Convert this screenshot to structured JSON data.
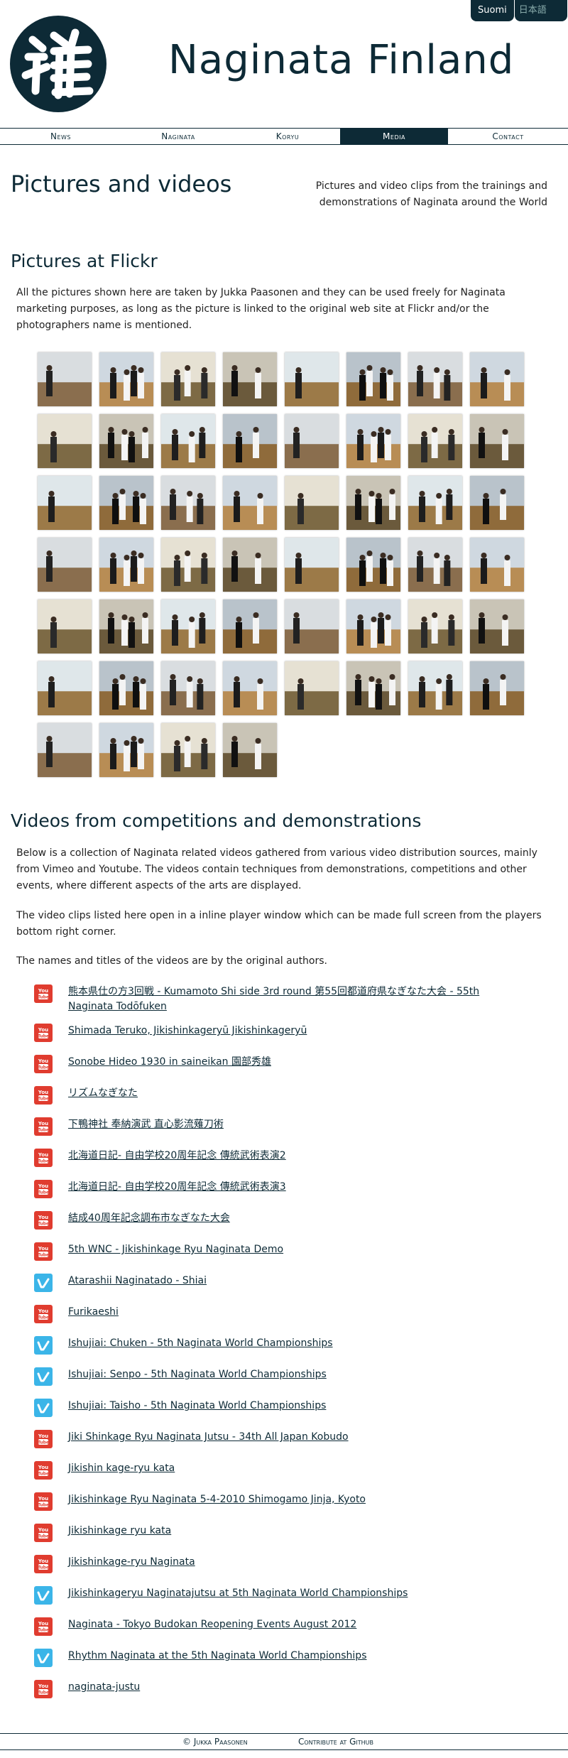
{
  "header": {
    "brand_title": "Naginata Finland",
    "language_link": "Suomi",
    "language_link_2": "日本語"
  },
  "nav": [
    {
      "label": "News"
    },
    {
      "label": "Naginata"
    },
    {
      "label": "Koryu"
    },
    {
      "label": "Media"
    },
    {
      "label": "Contact"
    }
  ],
  "page": {
    "title": "Pictures and videos",
    "intro": "Pictures and video clips from the trainings and demonstrations of Naginata around the World"
  },
  "flickr": {
    "heading": "Pictures at Flickr",
    "description": "All the pictures shown here are taken by Jukka Paasonen and they can be used freely for Naginata marketing purposes, as long as the picture is linked to the original web site at Flickr and/or the photographers name is mentioned.",
    "photo_count": 52
  },
  "videos": {
    "heading": "Videos from competitions and demonstrations",
    "paragraph1": "Below is a collection of Naginata related videos gathered from various video distribution sources, mainly from Vimeo and Youtube. The videos contain techniques from demonstrations, competitions and other events, where different aspects of the arts are displayed.",
    "paragraph2": "The video clips listed here open in a inline player window which can be made full screen from the players bottom right corner.",
    "paragraph3": "The names and titles of the videos are by the original authors.",
    "items": [
      {
        "title": "熊本県仕の方3回戦 - Kumamoto Shi side 3rd round 第55回都道府県なぎなた大会 - 55th Naginata Todōfuken",
        "source": "youtube"
      },
      {
        "title": "Shimada Teruko, Jikishinkageryū Jikishinkageryū",
        "source": "youtube"
      },
      {
        "title": "Sonobe Hideo 1930 in saineikan 園部秀雄",
        "source": "youtube"
      },
      {
        "title": "リズムなぎなた",
        "source": "youtube"
      },
      {
        "title": "下鴨神社 奉納演武 直心影流薙刀術",
        "source": "youtube"
      },
      {
        "title": "北海道日記- 自由学校20周年記念 傳統武術表演2",
        "source": "youtube"
      },
      {
        "title": "北海道日記- 自由学校20周年記念 傳統武術表演3",
        "source": "youtube"
      },
      {
        "title": "結成40周年記念調布市なぎなた大会",
        "source": "youtube"
      },
      {
        "title": "5th WNC - Jikishinkage Ryu Naginata Demo",
        "source": "youtube"
      },
      {
        "title": "Atarashii Naginatado - Shiai",
        "source": "vimeo"
      },
      {
        "title": "Furikaeshi",
        "source": "youtube"
      },
      {
        "title": "Ishujiai: Chuken - 5th Naginata World Championships",
        "source": "vimeo"
      },
      {
        "title": "Ishujiai: Senpo - 5th Naginata World Championships",
        "source": "vimeo"
      },
      {
        "title": "Ishujiai: Taisho - 5th Naginata World Championships",
        "source": "vimeo"
      },
      {
        "title": "Jiki Shinkage Ryu Naginata Jutsu - 34th All Japan Kobudo",
        "source": "youtube"
      },
      {
        "title": "Jikishin kage-ryu kata",
        "source": "youtube"
      },
      {
        "title": "Jikishinkage Ryu Naginata 5-4-2010 Shimogamo Jinja, Kyoto",
        "source": "youtube"
      },
      {
        "title": "Jikishinkage ryu kata",
        "source": "youtube"
      },
      {
        "title": "Jikishinkage-ryu Naginata",
        "source": "youtube"
      },
      {
        "title": "Jikishinkageryu Naginatajutsu at 5th Naginata World Championships",
        "source": "vimeo"
      },
      {
        "title": "Naginata - Tokyo Budokan Reopening Events August 2012",
        "source": "youtube"
      },
      {
        "title": "Rhythm Naginata at the 5th Naginata World Championships",
        "source": "vimeo"
      },
      {
        "title": "naginata-justu",
        "source": "youtube"
      }
    ]
  },
  "footer": {
    "copyright": "© Jukka Paasonen",
    "github": "Contribute at Github"
  },
  "colors": {
    "brand": "#0d2a36",
    "youtube": "#e03c2f",
    "vimeo": "#3bb5e8"
  }
}
